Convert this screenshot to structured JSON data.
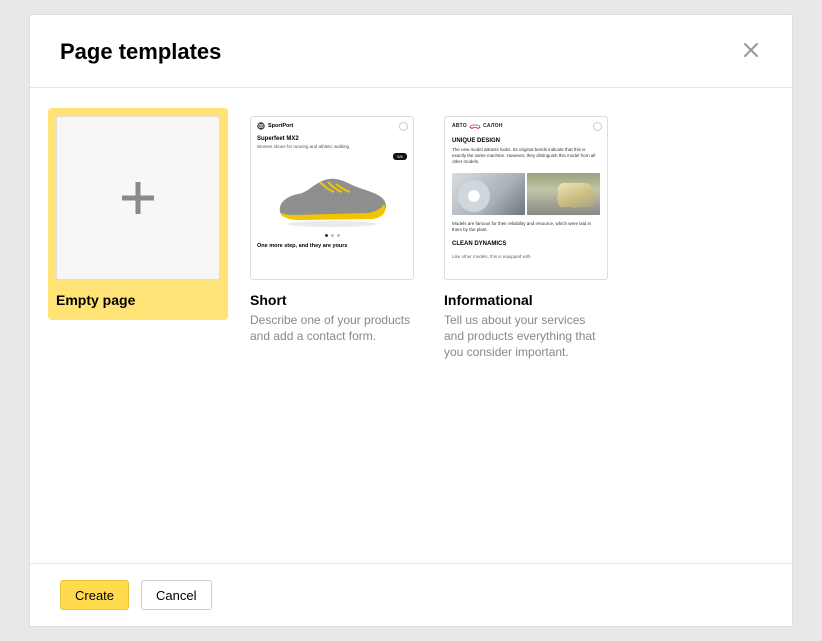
{
  "modal": {
    "title": "Page templates"
  },
  "templates": {
    "empty": {
      "title": "Empty page"
    },
    "short": {
      "title": "Short",
      "desc": "Describe one of your products and add a contact form.",
      "thumb": {
        "brand": "SportPort",
        "heading": "Superfeet MX2",
        "sub": "Women shoes for running and athletic walking.",
        "pill": "5/6",
        "footer": "One more step, and they are yours"
      }
    },
    "info": {
      "title": "Informational",
      "desc": "Tell us about your services and products everything that you consider important.",
      "thumb": {
        "brand_left": "АВТО",
        "brand_right": "САЛОН",
        "h1": "UNIQUE DESIGN",
        "p1": "The new model attracts looks. Its original bends indicate that this is exactly the same machine. However, they distinguish this model from all other models.",
        "p2": "Models are famous for their reliability and resource, which were laid in them by the plant.",
        "h2": "CLEAN DYNAMICS",
        "cut": "Like other models, this is equipped with"
      }
    }
  },
  "footer": {
    "create": "Create",
    "cancel": "Cancel"
  }
}
